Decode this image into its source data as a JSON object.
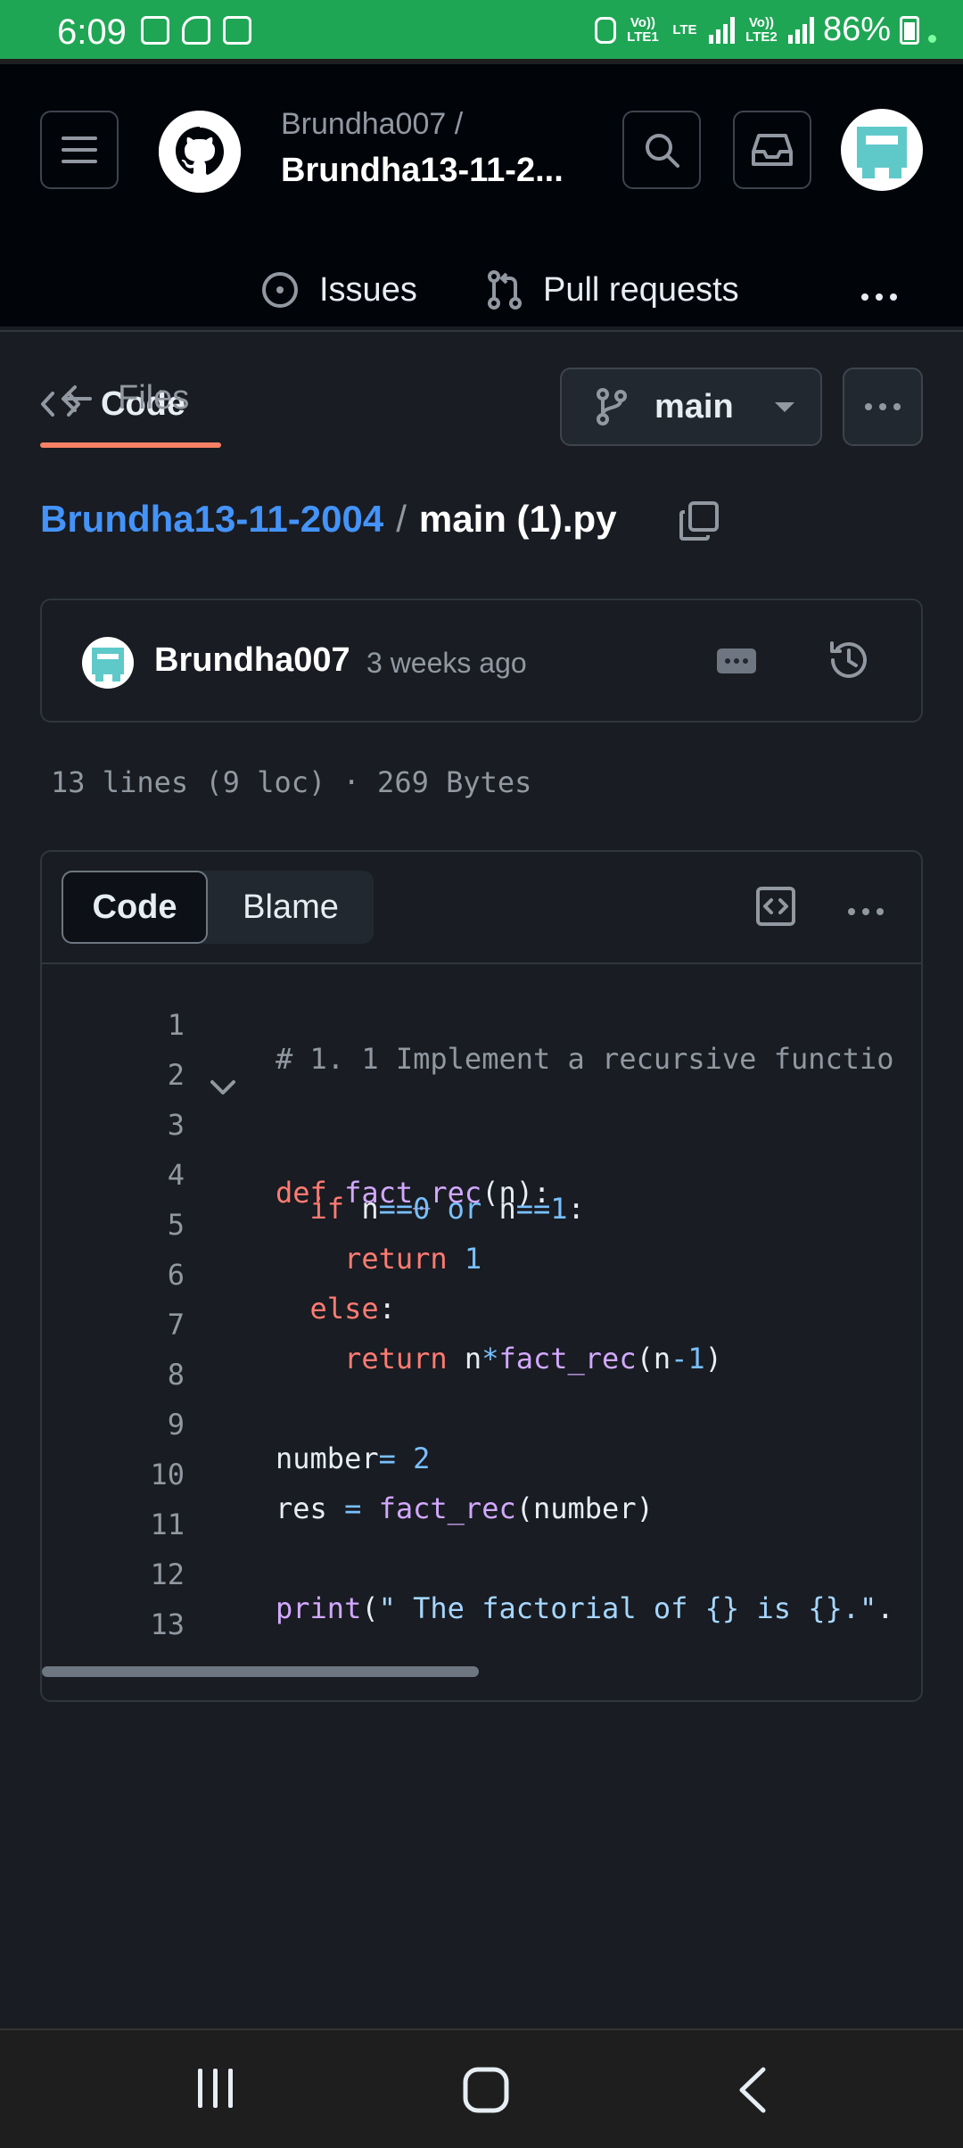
{
  "status_bar": {
    "time": "6:09",
    "lte1_label": "Vo)) LTE1",
    "lte_label": "LTE",
    "lte2_label": "Vo)) LTE2",
    "battery": "86%"
  },
  "header": {
    "owner": "Brundha007 /",
    "repo": "Brundha13-11-2...",
    "tabs": [
      {
        "label": "Code",
        "icon": "code-icon",
        "active": true
      },
      {
        "label": "Issues",
        "icon": "issue-icon"
      },
      {
        "label": "Pull requests",
        "icon": "pull-request-icon"
      }
    ]
  },
  "toolbar": {
    "back_label": "Files",
    "branch": "main"
  },
  "breadcrumb": {
    "repo": "Brundha13-11-2004",
    "separator": "/",
    "file": "main (1).py"
  },
  "commit": {
    "author": "Brundha007",
    "time": "3 weeks ago"
  },
  "file_info": "13 lines (9 loc) · 269 Bytes",
  "viewer": {
    "code_tab": "Code",
    "blame_tab": "Blame"
  },
  "code_lines": [
    {
      "n": "1",
      "text": "# 1. 1 Implement a recursive functio"
    },
    {
      "n": "2",
      "text": ""
    },
    {
      "n": "3",
      "text": "def fact_rec(n):"
    },
    {
      "n": "4",
      "text": "  if n==0 or n==1:"
    },
    {
      "n": "5",
      "text": "    return 1"
    },
    {
      "n": "6",
      "text": "  else:"
    },
    {
      "n": "7",
      "text": "    return n*fact_rec(n-1)"
    },
    {
      "n": "8",
      "text": ""
    },
    {
      "n": "9",
      "text": "number= 2"
    },
    {
      "n": "10",
      "text": "res = fact_rec(number)"
    },
    {
      "n": "11",
      "text": ""
    },
    {
      "n": "12",
      "text": "print(\" The factorial of {} is {}.\"."
    },
    {
      "n": "13",
      "text": ""
    }
  ],
  "colors": {
    "status_bar": "#1fa655",
    "accent_blue": "#4493f8",
    "tab_underline": "#f78166",
    "keyword": "#ff7b72",
    "function": "#d2a8ff",
    "number": "#79c0ff"
  }
}
